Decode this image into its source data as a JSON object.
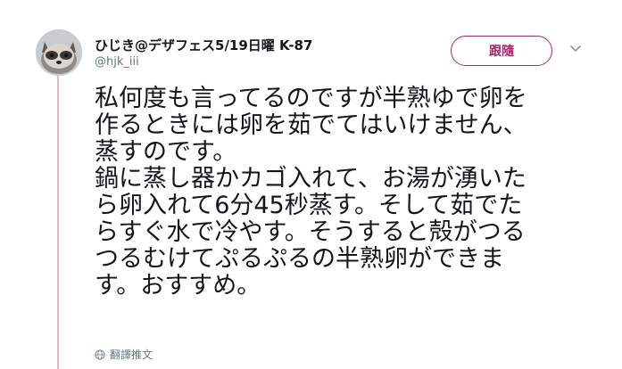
{
  "colors": {
    "accent": "#b0246e",
    "thread_line": "#e6b6cf",
    "text": "#14171a",
    "muted": "#657786"
  },
  "author": {
    "display_name": "ひじき@デザフェス5/19日曜 K-87",
    "handle": "@hjk_iii",
    "avatar_icon": "raccoon-dog-avatar"
  },
  "follow_button": {
    "label": "跟隨"
  },
  "menu": {
    "icon": "chevron-down-icon"
  },
  "tweet": {
    "lines": [
      "私何度も言ってるのですが半熟ゆで卵を",
      "作るときには卵を茹でてはいけません、",
      "蒸すのです。",
      "鍋に蒸し器かカゴ入れて、お湯が湧いた",
      "ら卵入れて6分45秒蒸す。そして茹でた",
      "らすぐ水で冷やす。そうすると殻がつる",
      "つるむけてぷるぷるの半熟卵ができま",
      "す。おすすめ。"
    ]
  },
  "translate": {
    "icon": "globe-icon",
    "label": "翻譯推文"
  }
}
